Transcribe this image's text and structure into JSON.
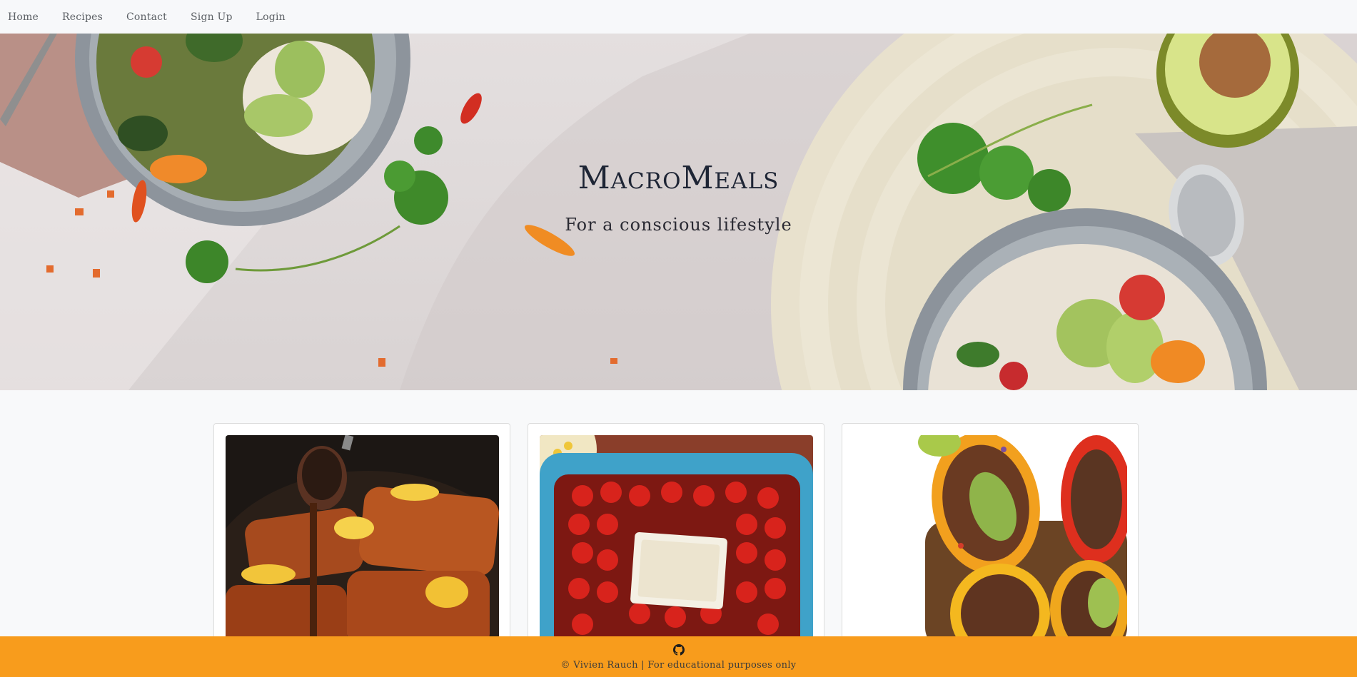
{
  "nav": {
    "items": [
      {
        "label": "Home"
      },
      {
        "label": "Recipes"
      },
      {
        "label": "Contact"
      },
      {
        "label": "Sign Up"
      },
      {
        "label": "Login"
      }
    ]
  },
  "hero": {
    "brand": "MacroMeals",
    "tagline": "For a conscious lifestyle"
  },
  "cards": [
    {
      "image": "salmon-dish-image"
    },
    {
      "image": "baked-feta-tomato-image"
    },
    {
      "image": "stuffed-peppers-image"
    }
  ],
  "footer": {
    "icon": "github-icon",
    "text": "© Vivien Rauch | For educational purposes only"
  },
  "colors": {
    "footer_bg": "#f89c1c",
    "navbar_bg": "#f7f8fa",
    "page_bg": "#f8f9fa"
  }
}
